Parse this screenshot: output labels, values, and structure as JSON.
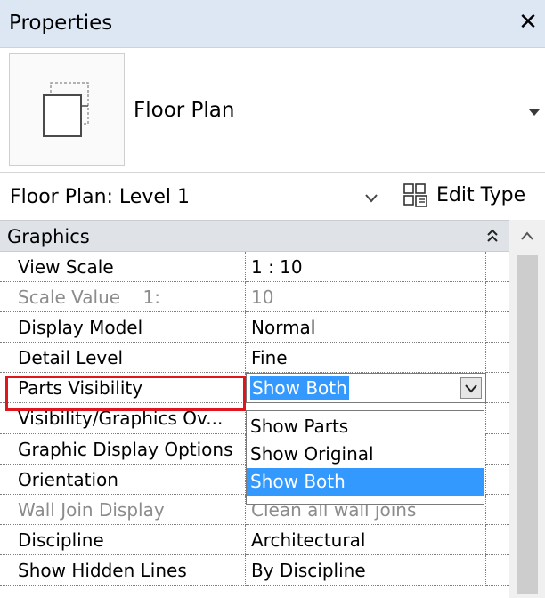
{
  "panel": {
    "title": "Properties",
    "close_glyph": "✕"
  },
  "type_selector": {
    "icon": "floor-plan-thumbnail-icon",
    "type_name": "Floor Plan"
  },
  "instance_selector": {
    "value": "Floor Plan: Level 1",
    "edit_type_label": "Edit Type"
  },
  "group": {
    "label": "Graphics"
  },
  "rows": [
    {
      "name": "View Scale",
      "value": "1 : 10",
      "enabled": true
    },
    {
      "name": "Scale Value    1:",
      "value": "10",
      "enabled": false
    },
    {
      "name": "Display Model",
      "value": "Normal",
      "enabled": true
    },
    {
      "name": "Detail Level",
      "value": "Fine",
      "enabled": true
    },
    {
      "name": "Parts Visibility",
      "value": "Show Both",
      "enabled": true
    },
    {
      "name": "Visibility/Graphics Ov...",
      "value": "",
      "enabled": true
    },
    {
      "name": "Graphic Display Options",
      "value": "",
      "enabled": true
    },
    {
      "name": "Orientation",
      "value": "",
      "enabled": true
    },
    {
      "name": "Wall Join Display",
      "value": "Clean all wall joins",
      "enabled": false
    },
    {
      "name": "Discipline",
      "value": "Architectural",
      "enabled": true
    },
    {
      "name": "Show Hidden Lines",
      "value": "By Discipline",
      "enabled": true
    }
  ],
  "dropdown": {
    "options": [
      "Show Parts",
      "Show Original",
      "Show Both"
    ],
    "selected": "Show Both"
  },
  "colors": {
    "title_bar": "#dde7f3",
    "selection": "#3399ff",
    "highlight": "#e0161e",
    "group_header": "#dfe3e8"
  }
}
